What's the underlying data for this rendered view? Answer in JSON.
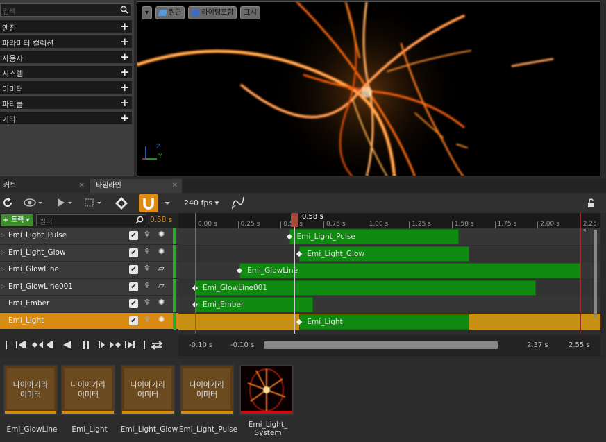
{
  "library": {
    "search_placeholder": "검색",
    "categories": [
      "엔진",
      "파라미터 컬렉션",
      "사용자",
      "시스템",
      "이미터",
      "파티클",
      "기타"
    ]
  },
  "viewport": {
    "menu_button": "▾",
    "perspective_label": "원근",
    "lighting_label": "라이팅포함",
    "show_label": "표시",
    "axis_z": "Z",
    "axis_y": "Y"
  },
  "tabs": [
    {
      "label": "커브",
      "close": "✕"
    },
    {
      "label": "타임라인",
      "close": "✕"
    }
  ],
  "toolbar": {
    "fps_label": "240 fps"
  },
  "track_header": {
    "add_track_label": "트랙",
    "filter_placeholder": "필터",
    "current_time": "0.58 s"
  },
  "tracks": [
    {
      "name": "Emi_Light_Pulse",
      "icon": "✺",
      "expandable": true
    },
    {
      "name": "Emi_Light_Glow",
      "icon": "✺",
      "expandable": true
    },
    {
      "name": "Emi_GlowLine",
      "icon": "▱",
      "expandable": true
    },
    {
      "name": "Emi_GlowLine001",
      "icon": "▱",
      "expandable": true
    },
    {
      "name": "Emi_Ember",
      "icon": "✺",
      "expandable": false
    },
    {
      "name": "Emi_Light",
      "icon": "✺",
      "expandable": true,
      "selected": true
    }
  ],
  "timeline": {
    "playhead_label": "0.58 s",
    "ticks": [
      "0.00 s",
      "0.25 s",
      "0.50 s",
      "0.75 s",
      "1.00 s",
      "1.25 s",
      "1.50 s",
      "1.75 s",
      "2.00 s",
      "2.25 s"
    ],
    "bars": [
      {
        "label": "Emi_Light_Pulse",
        "start_s": 0.55,
        "end_s": 1.54
      },
      {
        "label": "Emi_Light_Glow",
        "start_s": 0.61,
        "end_s": 1.6
      },
      {
        "label": "Emi_GlowLine",
        "start_s": 0.26,
        "end_s": 2.25
      },
      {
        "label": "Emi_GlowLine001",
        "start_s": 0.0,
        "end_s": 1.99
      },
      {
        "label": "Emi_Ember",
        "start_s": 0.0,
        "end_s": 0.69
      },
      {
        "label": "Emi_Light",
        "start_s": 0.61,
        "end_s": 1.6
      }
    ]
  },
  "playback": {
    "view_start": "-0.10 s",
    "working_start": "-0.10 s",
    "working_end": "2.37 s",
    "view_end": "2.55 s"
  },
  "assets": [
    {
      "thumb": "나이아가라\n이미터",
      "label": "Emi_GlowLine"
    },
    {
      "thumb": "나이아가라\n이미터",
      "label": "Emi_Light"
    },
    {
      "thumb": "나이아가라\n이미터",
      "label": "Emi_Light_Glow"
    },
    {
      "thumb": "나이아가라\n이미터",
      "label": "Emi_Light_Pulse"
    },
    {
      "thumb": "",
      "label": "Emi_Light_\nSystem"
    }
  ],
  "colors": {
    "track_active": "#2da62d",
    "bar": "#118a11",
    "selected_row": "#d98a10",
    "playhead": "#c0503a"
  }
}
